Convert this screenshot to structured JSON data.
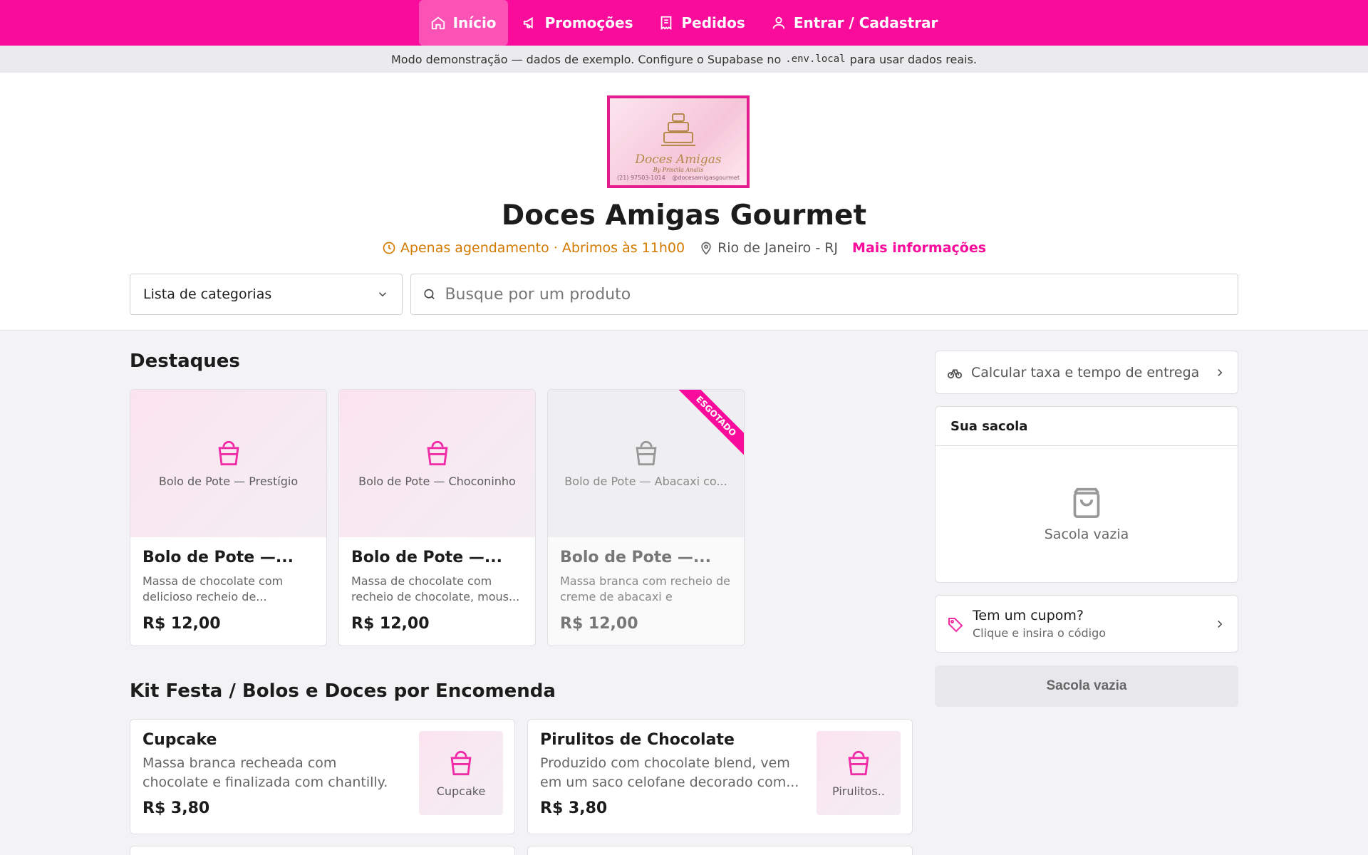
{
  "nav": {
    "home": "Início",
    "promos": "Promoções",
    "orders": "Pedidos",
    "login": "Entrar / Cadastrar"
  },
  "demo_banner": {
    "before": "Modo demonstração — dados de exemplo. Configure o Supabase no",
    "code": ".env.local",
    "after": "para usar dados reais."
  },
  "store": {
    "logo_title": "Doces Amigas",
    "logo_sub": "By Priscila Analis",
    "logo_phone": "(21) 97503-1014",
    "logo_handle": "@docesamigasgourmet",
    "name": "Doces Amigas Gourmet",
    "schedule": "Apenas agendamento · Abrimos às 11h00",
    "location": "Rio de Janeiro - RJ",
    "more_info": "Mais informações"
  },
  "filters": {
    "category_select": "Lista de categorias",
    "search_placeholder": "Busque por um produto"
  },
  "highlights": {
    "title": "Destaques",
    "items": [
      {
        "img_label": "Bolo de Pote — Prestígio",
        "name": "Bolo de Pote —...",
        "desc": "Massa de chocolate com delicioso recheio de...",
        "price": "R$ 12,00"
      },
      {
        "img_label": "Bolo de Pote — Choconinho",
        "name": "Bolo de Pote —...",
        "desc": "Massa de chocolate com recheio de chocolate, mous...",
        "price": "R$ 12,00"
      },
      {
        "img_label": "Bolo de Pote — Abacaxi co...",
        "name": "Bolo de Pote —...",
        "desc": "Massa branca com recheio de creme de abacaxi e pedaços...",
        "price": "R$ 12,00",
        "badge": "ESGOTADO"
      }
    ]
  },
  "kit": {
    "title": "Kit Festa / Bolos e Doces por Encomenda",
    "items": [
      {
        "name": "Cupcake",
        "desc": "Massa branca recheada com chocolate e finalizada com chantilly. Uma...",
        "price": "R$ 3,80",
        "img_label": "Cupcake"
      },
      {
        "name": "Pirulitos de Chocolate",
        "desc": "Produzido com chocolate blend, vem em um saco celofane decorado com...",
        "price": "R$ 3,80",
        "img_label": "Pirulitos.."
      }
    ]
  },
  "sidebar": {
    "delivery": "Calcular taxa e tempo de entrega",
    "bag_title": "Sua sacola",
    "bag_empty": "Sacola vazia",
    "coupon_title": "Tem um cupom?",
    "coupon_sub": "Clique e insira o código",
    "bag_button": "Sacola vazia"
  },
  "colors": {
    "brand": "#f90b9b",
    "schedule": "#d47a00"
  }
}
